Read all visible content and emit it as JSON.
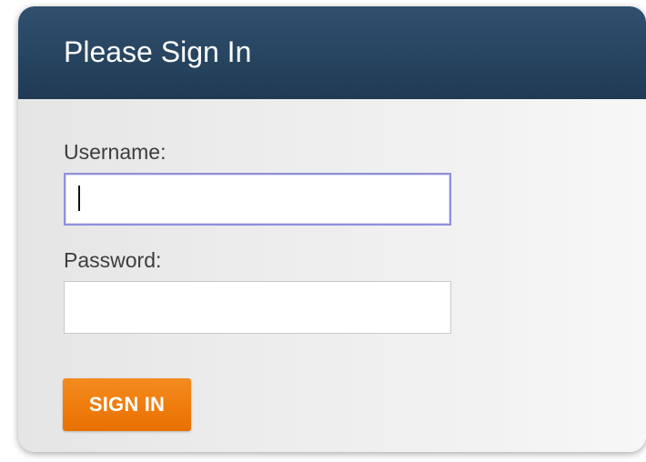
{
  "login": {
    "title": "Please Sign In",
    "username_label": "Username:",
    "username_value": "",
    "password_label": "Password:",
    "password_value": "",
    "sign_in_label": "SIGN IN"
  },
  "colors": {
    "header_blue": "#294763",
    "accent_orange": "#ef7c0d",
    "focus_border": "#8e90d9"
  }
}
